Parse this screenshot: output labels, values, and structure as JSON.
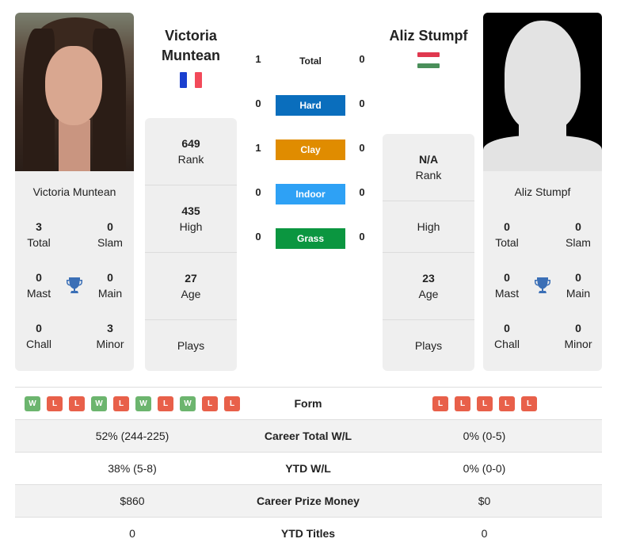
{
  "player1": {
    "name_line1": "Victoria",
    "name_line2": "Muntean",
    "full_name": "Victoria Muntean",
    "country_flag": "france-flag",
    "titles": {
      "total": "3",
      "total_label": "Total",
      "slam": "0",
      "slam_label": "Slam",
      "mast": "0",
      "mast_label": "Mast",
      "main": "0",
      "main_label": "Main",
      "chall": "0",
      "chall_label": "Chall",
      "minor": "3",
      "minor_label": "Minor"
    },
    "rank": "649",
    "rank_label": "Rank",
    "high": "435",
    "high_label": "High",
    "age": "27",
    "age_label": "Age",
    "plays": "",
    "plays_label": "Plays"
  },
  "player2": {
    "name": "Aliz Stumpf",
    "full_name": "Aliz Stumpf",
    "country_flag": "hungary-flag",
    "titles": {
      "total": "0",
      "total_label": "Total",
      "slam": "0",
      "slam_label": "Slam",
      "mast": "0",
      "mast_label": "Mast",
      "main": "0",
      "main_label": "Main",
      "chall": "0",
      "chall_label": "Chall",
      "minor": "0",
      "minor_label": "Minor"
    },
    "rank": "N/A",
    "rank_label": "Rank",
    "high": "",
    "high_label": "High",
    "age": "23",
    "age_label": "Age",
    "plays": "",
    "plays_label": "Plays"
  },
  "h2h": {
    "total": {
      "label": "Total",
      "p1": "1",
      "p2": "0"
    },
    "surfaces": [
      {
        "label": "Hard",
        "p1": "0",
        "p2": "0",
        "color": "#0a6ebd"
      },
      {
        "label": "Clay",
        "p1": "1",
        "p2": "0",
        "color": "#e08c00"
      },
      {
        "label": "Indoor",
        "p1": "0",
        "p2": "0",
        "color": "#2ea1f5"
      },
      {
        "label": "Grass",
        "p1": "0",
        "p2": "0",
        "color": "#0b9640"
      }
    ]
  },
  "comparison": {
    "form": {
      "label": "Form",
      "p1": [
        "W",
        "L",
        "L",
        "W",
        "L",
        "W",
        "L",
        "W",
        "L",
        "L"
      ],
      "p2": [
        "L",
        "L",
        "L",
        "L",
        "L"
      ]
    },
    "rows": [
      {
        "label": "Career Total W/L",
        "p1": "52% (244-225)",
        "p2": "0% (0-5)"
      },
      {
        "label": "YTD W/L",
        "p1": "38% (5-8)",
        "p2": "0% (0-0)"
      },
      {
        "label": "Career Prize Money",
        "p1": "$860",
        "p2": "$0"
      },
      {
        "label": "YTD Titles",
        "p1": "0",
        "p2": "0"
      }
    ]
  },
  "colors": {
    "win": "#6cb56e",
    "loss": "#e8604a",
    "trophy": "#3b6fb6",
    "card_bg": "#efefef"
  }
}
